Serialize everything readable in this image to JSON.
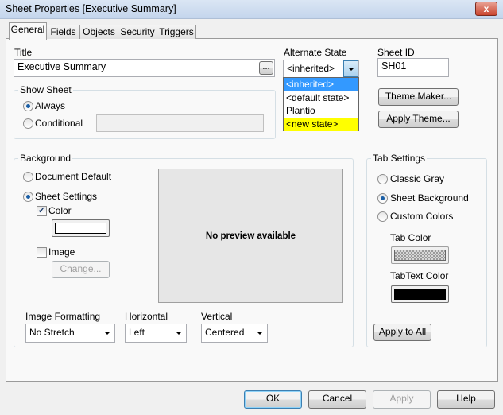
{
  "window": {
    "title": "Sheet Properties [Executive Summary]",
    "close": "x"
  },
  "tabs": [
    {
      "label": "General",
      "active": true
    },
    {
      "label": "Fields"
    },
    {
      "label": "Objects"
    },
    {
      "label": "Security"
    },
    {
      "label": "Triggers"
    }
  ],
  "title_field": {
    "label": "Title",
    "value": "Executive Summary",
    "browse": "..."
  },
  "alternate_state": {
    "label": "Alternate State",
    "value": "<inherited>",
    "options": [
      "<inherited>",
      "<default state>",
      "Plantio",
      "<new state>"
    ],
    "highlight_color": "#ffff00",
    "selected_color": "#3399ff"
  },
  "sheet_id": {
    "label": "Sheet ID",
    "value": "SH01"
  },
  "theme": {
    "maker": "Theme Maker...",
    "apply": "Apply Theme..."
  },
  "show_sheet": {
    "label": "Show Sheet",
    "always": "Always",
    "conditional": "Conditional",
    "selected": "Always"
  },
  "background": {
    "label": "Background",
    "document_default": "Document Default",
    "sheet_settings": "Sheet Settings",
    "selected": "Sheet Settings",
    "color": "Color",
    "color_checked": true,
    "image": "Image",
    "image_checked": false,
    "change": "Change...",
    "preview": "No preview available",
    "image_formatting": {
      "label": "Image Formatting",
      "value": "No Stretch"
    },
    "horizontal": {
      "label": "Horizontal",
      "value": "Left"
    },
    "vertical": {
      "label": "Vertical",
      "value": "Centered"
    }
  },
  "tab_settings": {
    "label": "Tab Settings",
    "classic_gray": "Classic Gray",
    "sheet_background": "Sheet Background",
    "custom_colors": "Custom Colors",
    "selected": "Sheet Background",
    "tab_color": "Tab Color",
    "tabtext_color": "TabText Color",
    "tabtext_swatch": "#000000",
    "apply_all": "Apply to All"
  },
  "footer": {
    "ok": "OK",
    "cancel": "Cancel",
    "apply": "Apply",
    "help": "Help"
  }
}
